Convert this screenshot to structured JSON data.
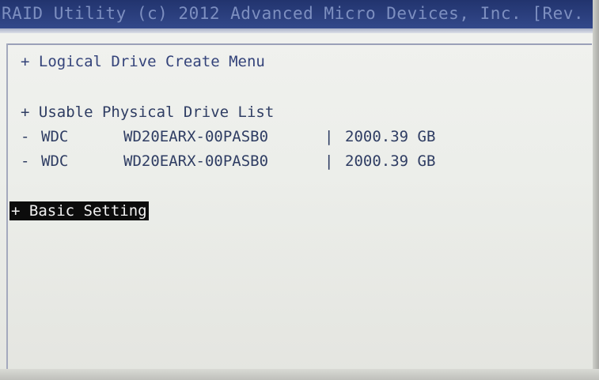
{
  "title_bar": {
    "text": "RAID Utility (c) 2012 Advanced Micro Devices, Inc. [Rev."
  },
  "menu": {
    "logical_drive_create": "+ Logical Drive Create Menu",
    "usable_drive_list_header": "+ Usable Physical Drive List",
    "drives": [
      {
        "dash": "-",
        "vendor": "WDC",
        "model": "WD20EARX-00PASB0",
        "separator": "|",
        "capacity": "2000.39 GB"
      },
      {
        "dash": "-",
        "vendor": "WDC",
        "model": "WD20EARX-00PASB0",
        "separator": "|",
        "capacity": "2000.39 GB"
      }
    ],
    "basic_setting": "+ Basic Setting"
  },
  "colors": {
    "title_bar_bg": "#2b3f7e",
    "screen_bg": "#eceeea",
    "text": "#2f3d63",
    "highlight_bg": "#0c0c0c",
    "highlight_text": "#f2f2f2"
  }
}
